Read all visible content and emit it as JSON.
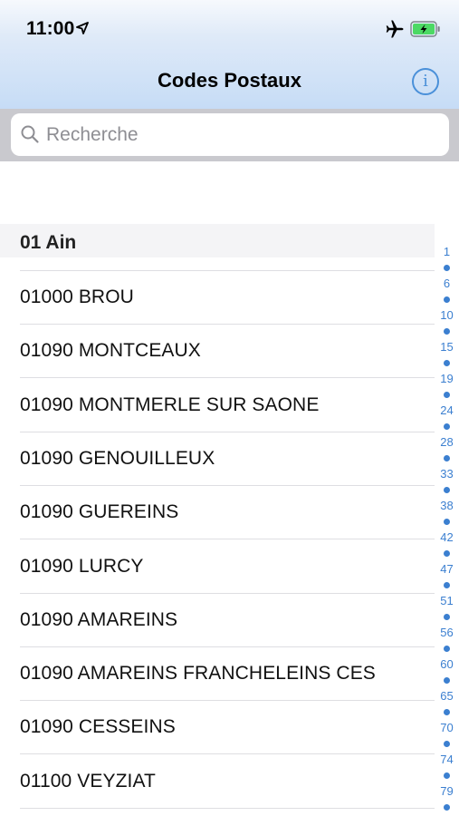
{
  "status_bar": {
    "time": "11:00",
    "icons": [
      "location-arrow-icon",
      "airplane-icon",
      "battery-charging-icon"
    ]
  },
  "nav": {
    "title": "Codes Postaux",
    "info_icon": "info-circle-icon",
    "info_glyph": "i"
  },
  "search": {
    "placeholder": "Recherche",
    "value": ""
  },
  "section": {
    "title": "01 Ain"
  },
  "rows": [
    "01000 BROU",
    "01090 MONTCEAUX",
    "01090 MONTMERLE SUR SAONE",
    "01090 GENOUILLEUX",
    "01090 GUEREINS",
    "01090 LURCY",
    "01090 AMAREINS",
    "01090 AMAREINS FRANCHELEINS CES",
    "01090 CESSEINS",
    "01100 VEYZIAT"
  ],
  "index": [
    "1",
    "6",
    "10",
    "15",
    "19",
    "24",
    "28",
    "33",
    "38",
    "42",
    "47",
    "51",
    "56",
    "60",
    "65",
    "70",
    "74",
    "79"
  ],
  "colors": {
    "accent": "#3b7fd0",
    "battery": "#4cd964",
    "search_bar_bg": "#c9c9ce",
    "section_bg": "#f4f4f6"
  }
}
